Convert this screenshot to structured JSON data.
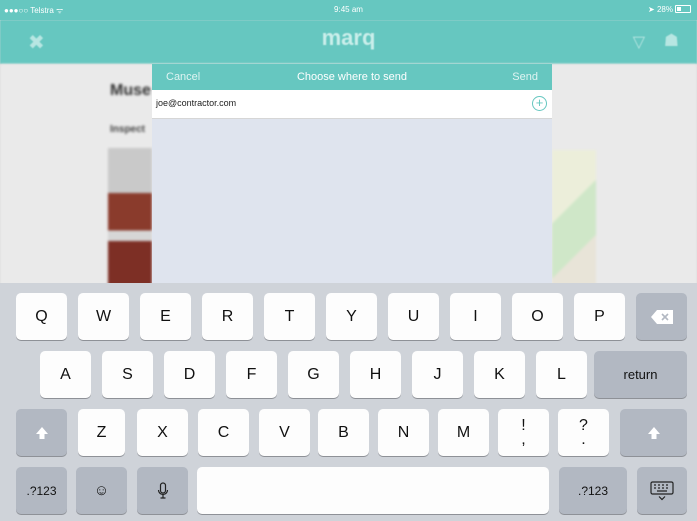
{
  "status_bar": {
    "carrier": "●●●○○ Telstra ᯤ",
    "time": "9:45 am",
    "battery": "28%"
  },
  "nav": {
    "logo": "marq",
    "close_icon": "x-icon",
    "filter_icon": "filter-icon",
    "bag_icon": "bag-icon"
  },
  "background_page": {
    "title": "Muse",
    "subtitle": "Inspect"
  },
  "modal": {
    "cancel": "Cancel",
    "title": "Choose where to send",
    "send": "Send",
    "recipient": "joe@contractor.com",
    "add_icon": "+"
  },
  "keyboard": {
    "row1": [
      "Q",
      "W",
      "E",
      "R",
      "T",
      "Y",
      "U",
      "I",
      "O",
      "P"
    ],
    "row2": [
      "A",
      "S",
      "D",
      "F",
      "G",
      "H",
      "J",
      "K",
      "L"
    ],
    "row3": [
      "Z",
      "X",
      "C",
      "V",
      "B",
      "N",
      "M"
    ],
    "return": "return",
    "numbers": ".?123",
    "punct_excl": [
      "!",
      ","
    ],
    "punct_q": [
      "?",
      "."
    ]
  }
}
